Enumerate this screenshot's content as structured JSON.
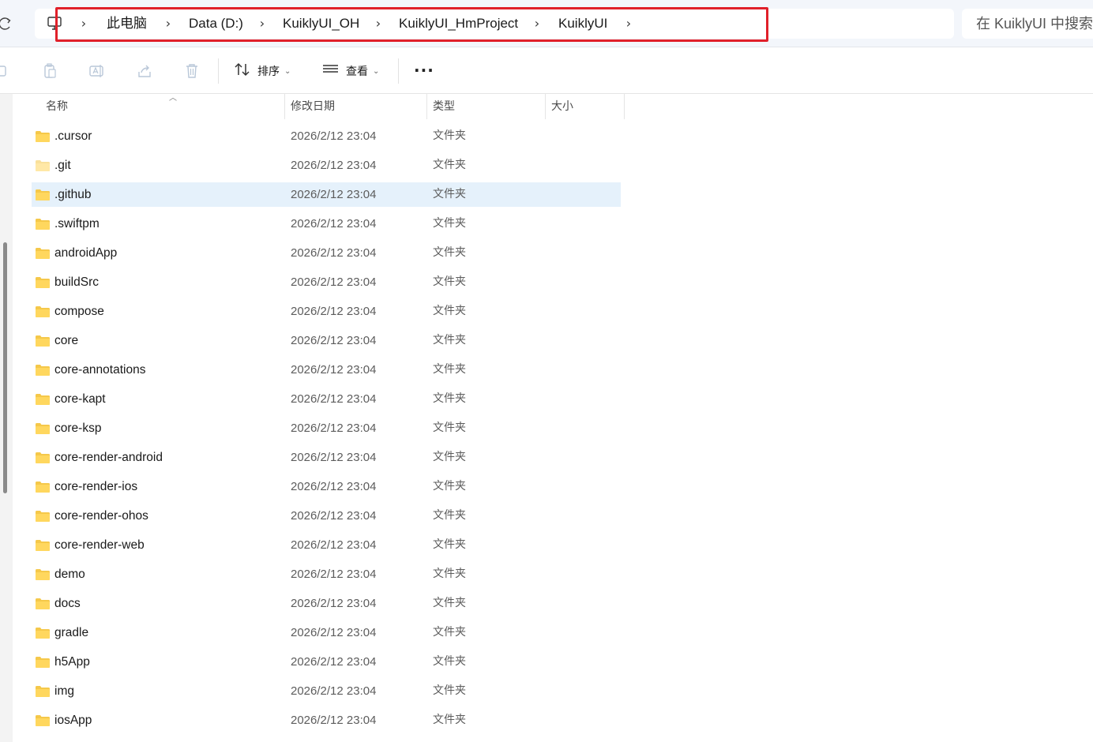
{
  "breadcrumb": {
    "items": [
      "此电脑",
      "Data (D:)",
      "KuiklyUI_OH",
      "KuiklyUI_HmProject",
      "KuiklyUI"
    ]
  },
  "search": {
    "placeholder": "在 KuiklyUI 中搜索"
  },
  "toolbar": {
    "sort_label": "排序",
    "view_label": "查看",
    "icons": [
      "copy-icon",
      "paste-icon",
      "rename-icon",
      "share-icon",
      "delete-icon"
    ]
  },
  "columns": {
    "name": "名称",
    "modified": "修改日期",
    "type": "类型",
    "size": "大小"
  },
  "files": [
    {
      "name": ".cursor",
      "date": "2026/2/12 23:04",
      "type": "文件夹"
    },
    {
      "name": ".git",
      "date": "2026/2/12 23:04",
      "type": "文件夹"
    },
    {
      "name": ".github",
      "date": "2026/2/12 23:04",
      "type": "文件夹"
    },
    {
      "name": ".swiftpm",
      "date": "2026/2/12 23:04",
      "type": "文件夹"
    },
    {
      "name": "androidApp",
      "date": "2026/2/12 23:04",
      "type": "文件夹"
    },
    {
      "name": "buildSrc",
      "date": "2026/2/12 23:04",
      "type": "文件夹"
    },
    {
      "name": "compose",
      "date": "2026/2/12 23:04",
      "type": "文件夹"
    },
    {
      "name": "core",
      "date": "2026/2/12 23:04",
      "type": "文件夹"
    },
    {
      "name": "core-annotations",
      "date": "2026/2/12 23:04",
      "type": "文件夹"
    },
    {
      "name": "core-kapt",
      "date": "2026/2/12 23:04",
      "type": "文件夹"
    },
    {
      "name": "core-ksp",
      "date": "2026/2/12 23:04",
      "type": "文件夹"
    },
    {
      "name": "core-render-android",
      "date": "2026/2/12 23:04",
      "type": "文件夹"
    },
    {
      "name": "core-render-ios",
      "date": "2026/2/12 23:04",
      "type": "文件夹"
    },
    {
      "name": "core-render-ohos",
      "date": "2026/2/12 23:04",
      "type": "文件夹"
    },
    {
      "name": "core-render-web",
      "date": "2026/2/12 23:04",
      "type": "文件夹"
    },
    {
      "name": "demo",
      "date": "2026/2/12 23:04",
      "type": "文件夹"
    },
    {
      "name": "docs",
      "date": "2026/2/12 23:04",
      "type": "文件夹"
    },
    {
      "name": "gradle",
      "date": "2026/2/12 23:04",
      "type": "文件夹"
    },
    {
      "name": "h5App",
      "date": "2026/2/12 23:04",
      "type": "文件夹"
    },
    {
      "name": "img",
      "date": "2026/2/12 23:04",
      "type": "文件夹"
    },
    {
      "name": "iosApp",
      "date": "2026/2/12 23:04",
      "type": "文件夹"
    }
  ],
  "selected_file": ".github",
  "colors": {
    "folder": "#f5c84a",
    "selection": "#e5f1fb",
    "highlight_box": "#e0202a",
    "topbar_bg": "#f3f6fb"
  }
}
